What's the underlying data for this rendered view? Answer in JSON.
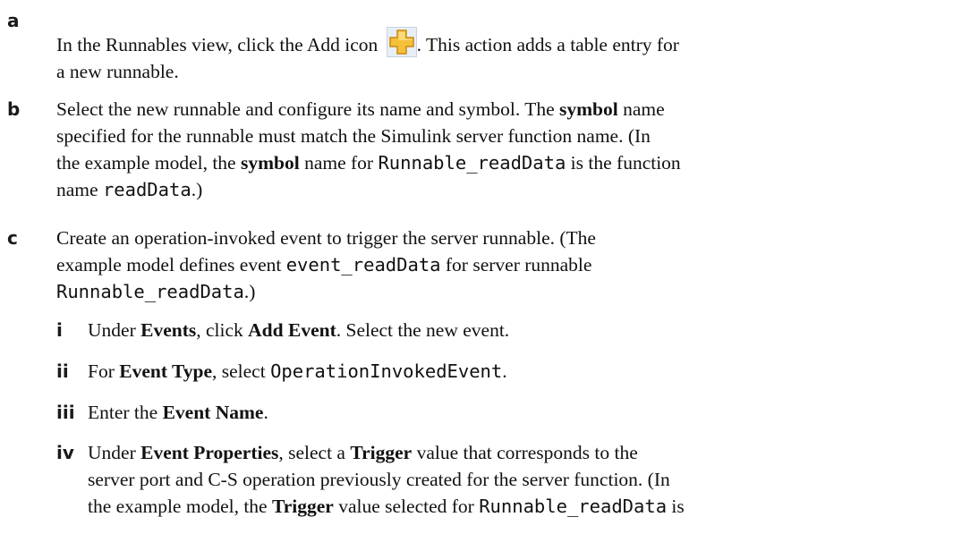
{
  "steps": {
    "a": {
      "marker": "a",
      "text_1": "In the Runnables view, click the Add icon ",
      "icon": "add-icon",
      "text_2": ". This action adds a table entry for",
      "text_3": "a new runnable."
    },
    "b": {
      "marker": "b",
      "l1_a": "Select the new runnable and configure its name and symbol. The ",
      "l1_bold": "symbol",
      "l1_b": " name",
      "l2": "specified for the runnable must match the Simulink server function name. (In",
      "l3_a": "the example model, the ",
      "l3_bold": "symbol",
      "l3_b": " name for ",
      "l3_code": "Runnable_readData",
      "l3_c": " is the function",
      "l4_a": "name ",
      "l4_code": "readData",
      "l4_b": ".)"
    },
    "c": {
      "marker": "c",
      "l1": "Create an operation-invoked event to trigger the server runnable. (The",
      "l2_a": "example model defines event ",
      "l2_code": "event_readData",
      "l2_b": " for server runnable",
      "l3_code": "Runnable_readData",
      "l3_b": ".)"
    },
    "i": {
      "marker": "i",
      "a": "Under ",
      "bold1": "Events",
      "b": ", click ",
      "bold2": "Add Event",
      "c": ". Select the new event."
    },
    "ii": {
      "marker": "ii",
      "a": "For ",
      "bold1": "Event Type",
      "b": ", select ",
      "code": "OperationInvokedEvent",
      "c": "."
    },
    "iii": {
      "marker": "iii",
      "a": "Enter the ",
      "bold1": "Event Name",
      "b": "."
    },
    "iv": {
      "marker": "iv",
      "l1_a": "Under ",
      "l1_bold1": "Event Properties",
      "l1_b": ", select a ",
      "l1_bold2": "Trigger",
      "l1_c": " value that corresponds to the",
      "l2": "server port and C-S operation previously created for the server function. (In",
      "l3_a": "the example model, the ",
      "l3_bold": "Trigger",
      "l3_b": " value selected for ",
      "l3_code": "Runnable_readData",
      "l3_c": " is"
    }
  },
  "colors": {
    "icon_fill": "#f5c13a",
    "icon_stroke": "#c98a12",
    "icon_bg": "#e8eef6"
  }
}
